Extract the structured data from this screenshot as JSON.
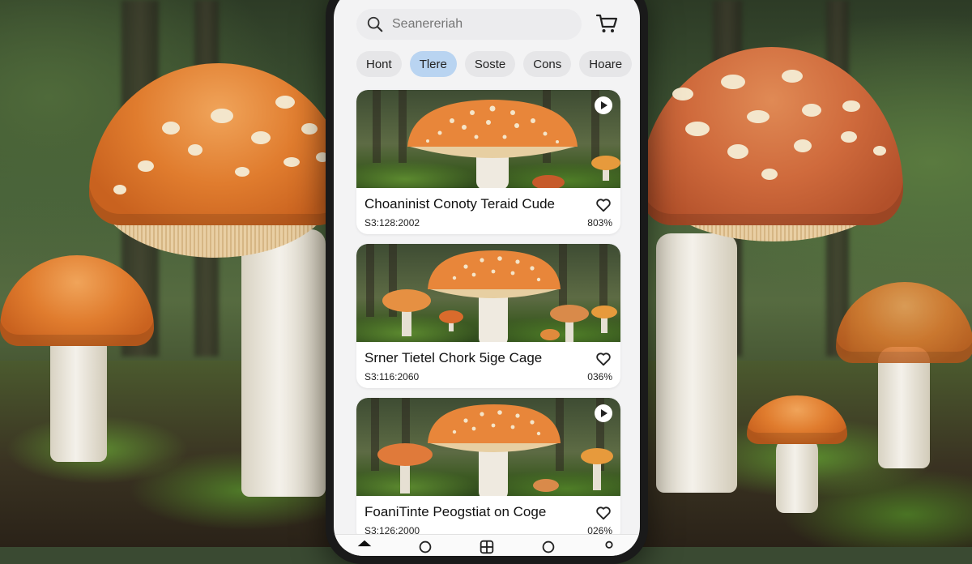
{
  "search": {
    "placeholder": "Seanereriah"
  },
  "header": {
    "cart_icon": "cart-icon"
  },
  "chips": [
    {
      "label": "Hont",
      "active": false
    },
    {
      "label": "Tlere",
      "active": true
    },
    {
      "label": "Soste",
      "active": false
    },
    {
      "label": "Cons",
      "active": false
    },
    {
      "label": "Hoare",
      "active": false
    }
  ],
  "cards": [
    {
      "title": "Choaninist Conoty Teraid Cude",
      "meta": "S3:128:2002",
      "percent": "803%",
      "has_play": true
    },
    {
      "title": "Srner Tietel Chork 5ige Cage",
      "meta": "S3:116:2060",
      "percent": "036%",
      "has_play": false
    },
    {
      "title": "FoaniTinte Peogstiat on Coge",
      "meta": "S3:126:2000",
      "percent": "026%",
      "has_play": true
    }
  ],
  "bottom_nav": [
    "home-icon",
    "search-icon",
    "grid-icon",
    "chat-icon",
    "profile-icon"
  ],
  "colors": {
    "accent_chip": "#b9d4f1",
    "cap_orange": "#e07c2e"
  }
}
